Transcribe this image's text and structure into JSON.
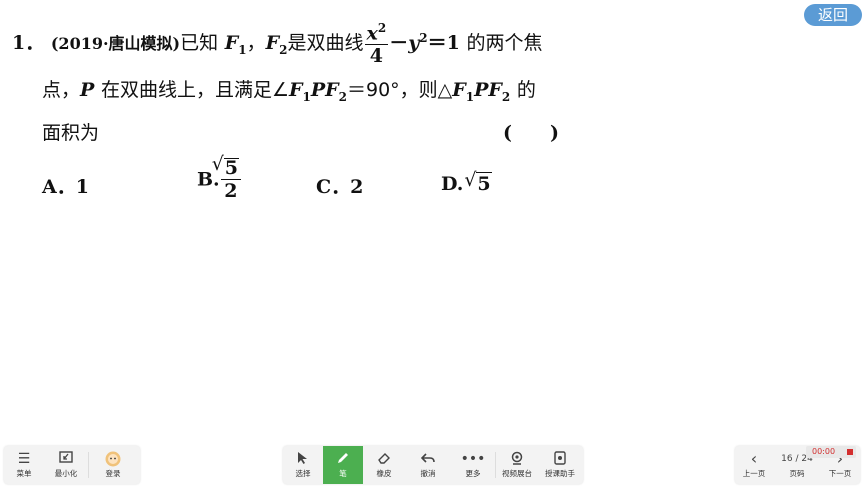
{
  "back_button": {
    "label": "返回"
  },
  "problem": {
    "number": "1．",
    "source": "(2019·唐山模拟)",
    "text_known": "已知",
    "F1": "F",
    "sub1": "1",
    "comma1": "，",
    "F2": "F",
    "sub2": "2",
    "text_is_hyperbola": "是双曲线",
    "frac_num": "x",
    "frac_num_sup": "2",
    "frac_den": "4",
    "minus": "－",
    "y": "y",
    "y_sup": "2",
    "equals_one": "＝1",
    "text_two_foci": "的两个焦",
    "line2_a": "点，",
    "P": "P",
    "line2_b": "在双曲线上，且满足∠",
    "angle_expr": "F",
    "angle_sub1": "1",
    "angle_P": "PF",
    "angle_sub2": "2",
    "angle_val": "＝90°，则△",
    "tri_F": "F",
    "tri_sub1": "1",
    "tri_P": "PF",
    "tri_sub2": "2",
    "line2_end": "的",
    "line3": "面积为",
    "blank": "(　　)"
  },
  "choices": {
    "A_label": "A．1",
    "B_label": "B.",
    "B_num": "5",
    "B_den": "2",
    "C_label": "C．2",
    "D_label": "D.",
    "D_val": "5"
  },
  "toolbar": {
    "left": [
      {
        "label": "菜单",
        "icon": "menu-icon"
      },
      {
        "label": "最小化",
        "icon": "minimize-icon"
      },
      {
        "label": "登录",
        "icon": "avatar-icon"
      }
    ],
    "center": [
      {
        "label": "选择",
        "icon": "cursor-icon"
      },
      {
        "label": "笔",
        "icon": "pen-icon"
      },
      {
        "label": "橡皮",
        "icon": "eraser-icon"
      },
      {
        "label": "撤消",
        "icon": "undo-icon"
      },
      {
        "label": "更多",
        "icon": "more-icon"
      },
      {
        "label": "视频展台",
        "icon": "camera-icon"
      },
      {
        "label": "授课助手",
        "icon": "assistant-icon"
      }
    ],
    "right": {
      "prev_label": "上一页",
      "page_indicator": "16 / 24",
      "page_label": "页码",
      "next_label": "下一页",
      "timer": "00:00"
    }
  },
  "colors": {
    "accent_green": "#4caf50",
    "back_button": "#5b9bd5",
    "timer_red": "#d32f2f"
  }
}
